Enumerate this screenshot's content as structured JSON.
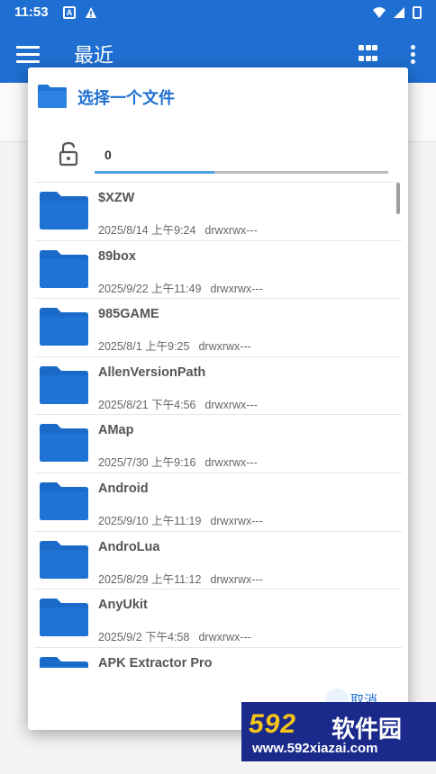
{
  "status_bar": {
    "time": "11:53",
    "notification_a": "A"
  },
  "app_bar": {
    "title": "最近"
  },
  "dialog": {
    "title": "选择一个文件",
    "path_segment": "0",
    "cancel_label": "取消",
    "files": [
      {
        "name": "$XZW",
        "date": "2025/8/14 上午9:24",
        "perm": "drwxrwx---"
      },
      {
        "name": "89box",
        "date": "2025/9/22 上午11:49",
        "perm": "drwxrwx---"
      },
      {
        "name": "985GAME",
        "date": "2025/8/1 上午9:25",
        "perm": "drwxrwx---"
      },
      {
        "name": "AllenVersionPath",
        "date": "2025/8/21 下午4:56",
        "perm": "drwxrwx---"
      },
      {
        "name": "AMap",
        "date": "2025/7/30 上午9:16",
        "perm": "drwxrwx---"
      },
      {
        "name": "Android",
        "date": "2025/9/10 上午11:19",
        "perm": "drwxrwx---"
      },
      {
        "name": "AndroLua",
        "date": "2025/8/29 上午11:12",
        "perm": "drwxrwx---"
      },
      {
        "name": "AnyUkit",
        "date": "2025/9/2 下午4:58",
        "perm": "drwxrwx---"
      },
      {
        "name": "APK Extractor Pro",
        "date": "",
        "perm": ""
      }
    ]
  },
  "watermark": {
    "logo": "592",
    "brand": "软件园",
    "url": "www.592xiazai.com"
  },
  "colors": {
    "primary": "#1f6fd2",
    "folder": "#1e73d4",
    "accent_line": "#4aa3e0"
  }
}
